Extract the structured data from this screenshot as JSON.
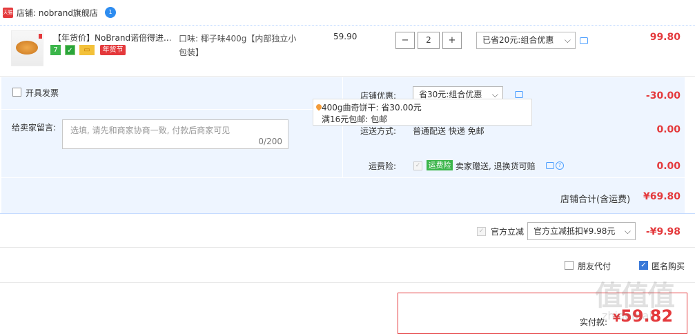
{
  "shop": {
    "badge": "天猫",
    "name": "店铺: nobrand旗舰店",
    "ww_icon": "1"
  },
  "product": {
    "title": "【年货价】NoBrand诺倍得进...",
    "tags": {
      "seven": "7",
      "year_fest": "年货节"
    },
    "sku": "口味: 椰子味400g【内部独立小包装】",
    "price": "59.90",
    "quantity": "2",
    "promo_select": "已省20元:组合优惠",
    "subtotal": "99.80"
  },
  "invoice": {
    "label": "开具发票"
  },
  "message": {
    "label": "给卖家留言:",
    "placeholder": "选填, 请先和商家协商一致, 付款后商家可见",
    "counter": "0/200"
  },
  "shop_discount": {
    "label": "店铺优惠:",
    "select": "省30元:组合优惠",
    "value": "-30.00",
    "tooltip_line1": "400g曲奇饼干: 省30.00元",
    "tooltip_line2": "满16元包邮: 包邮"
  },
  "shipping": {
    "label": "运送方式:",
    "method": "普通配送 快递 免邮",
    "value": "0.00"
  },
  "insurance": {
    "label": "运费险:",
    "tag": "运费险",
    "text": "卖家赠送, 退换货可赔",
    "value": "0.00"
  },
  "shop_total": {
    "label": "店铺合计(含运费)",
    "value": "¥69.80"
  },
  "official": {
    "label": "官方立减",
    "select": "官方立减抵扣¥9.98元",
    "value": "-¥9.98"
  },
  "options": {
    "friend_pay": "朋友代付",
    "anonymous": "匿名购买"
  },
  "payment": {
    "label": "实付款:",
    "currency": "¥",
    "amount": "59.82"
  },
  "watermark": {
    "main": "值值值",
    "sub": "zhidemai"
  },
  "colors": {
    "accent_red": "#e4393c",
    "link_blue": "#3a79d8",
    "panel_blue": "#eef5ff"
  }
}
